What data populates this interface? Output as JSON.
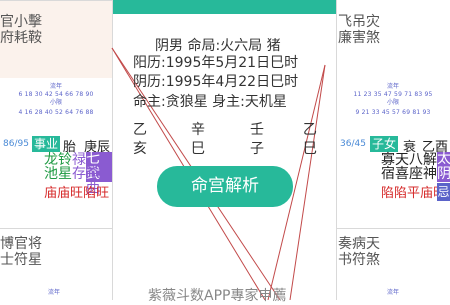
{
  "top_left": {
    "line1": "官小擊",
    "line2": "府耗鞍"
  },
  "top_right": {
    "line1": "飞吊灾",
    "line2": "廉害煞"
  },
  "left_panel": {
    "label1": "流年",
    "nums1": "6 18 30 42 54 66 78 90",
    "label2": "小限",
    "nums2": "4 16 28 40 52 64 76 88",
    "range": "86/95",
    "palace": "事业",
    "stem": "胎",
    "branch": "庚辰",
    "stars_row1": [
      "龙",
      "铃"
    ],
    "stars_row2": [
      "池",
      "星"
    ],
    "purple_row1": [
      "禄",
      "七",
      "武"
    ],
    "purple_row2": [
      "存",
      "杀",
      "曲"
    ],
    "status": [
      "庙",
      "庙",
      "旺",
      "陷",
      "旺"
    ]
  },
  "right_panel": {
    "label1": "流年",
    "nums1": "11 23 35 47 59 71 83 95",
    "label2": "小限",
    "nums2": "9 21 33 45 57 69 81 93",
    "range": "36/45",
    "palace": "子女",
    "stem": "衰",
    "branch": "乙酉",
    "stars_row1": [
      "寡",
      "天",
      "八",
      "解"
    ],
    "stars_row2": [
      "宿",
      "喜",
      "座",
      "神"
    ],
    "purple_col1": [
      "太",
      "阴"
    ],
    "status": [
      "陷",
      "陷",
      "平",
      "庙",
      "旺"
    ],
    "badge": "忌"
  },
  "bottom_left": {
    "line1": "博官将",
    "line2": "士符星",
    "label": "流年"
  },
  "bottom_right": {
    "line1": "奏病天",
    "line2": "书符煞",
    "label": "流年"
  },
  "center": {
    "line1": "阴男 命局:火六局 猪",
    "line2": "阳历:1995年5月21日巳时",
    "line3": "阴历:1995年4月22日巳时",
    "line4": "命主:贪狼星 身主:天机星",
    "stem_col1": [
      "乙",
      "亥"
    ],
    "stem_col2": [
      "辛",
      "巳"
    ],
    "stem_col3": [
      "壬",
      "子"
    ],
    "stem_col4": [
      "乙",
      "巳"
    ],
    "button": "命宫解析",
    "footer": "紫薇斗数APP專家申薦"
  },
  "colors": {
    "teal": "#27b99a",
    "purple": "#8a5bd1",
    "red": "#d62b2b",
    "green": "#1f9a43",
    "blue": "#5b63c9"
  }
}
